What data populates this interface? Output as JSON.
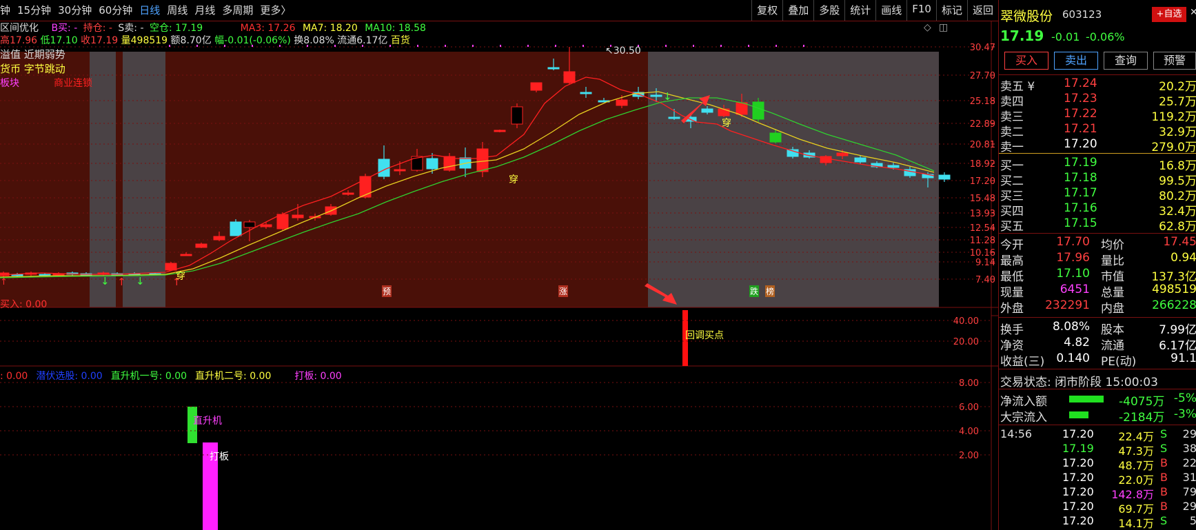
{
  "toolbar": {
    "periods": [
      {
        "label": "钟",
        "active": false
      },
      {
        "label": "15分钟",
        "active": false
      },
      {
        "label": "30分钟",
        "active": false
      },
      {
        "label": "60分钟",
        "active": false
      },
      {
        "label": "日线",
        "active": true
      },
      {
        "label": "周线",
        "active": false
      },
      {
        "label": "月线",
        "active": false
      },
      {
        "label": "多周期",
        "active": false
      },
      {
        "label": "更多",
        "active": false
      }
    ],
    "more_arrow": "〉",
    "right_items": [
      "复权",
      "叠加",
      "多股",
      "统计",
      "画线",
      "F10",
      "标记",
      "返回"
    ]
  },
  "info_line1": {
    "name": "区间优化",
    "b_buy": "B买: -",
    "hold": "持仓: -",
    "s_sell": "S卖: -",
    "empty": "空仓: 17.19",
    "ma3": "MA3: 17.26",
    "ma7": "MA7: 18.20",
    "ma10": "MA10: 18.58"
  },
  "info_line2": {
    "high": "高17.96",
    "low": "低17.10",
    "close": "收17.19",
    "vol": "量498519",
    "amount": "额8.70亿",
    "change": "幅-0.01(-0.06%)",
    "turnover": "换8.08%",
    "float": "流通6.17亿",
    "industry": "百货"
  },
  "overlay_tags": {
    "line1": "溢值 近期弱势",
    "line2": "货币 字节跳动",
    "line3a": "板块",
    "line3b": "商业连锁"
  },
  "price_axis": [
    "30.47",
    "27.70",
    "25.18",
    "22.89",
    "20.81",
    "18.92",
    "17.20",
    "15.48",
    "13.93",
    "12.54",
    "11.28",
    "10.16",
    "9.14",
    "7.40"
  ],
  "peak_label": "30.50",
  "chart_markers": {
    "chuan": "穿",
    "yu": "预",
    "zhang": "涨",
    "die": "跌",
    "bang": "榜"
  },
  "sub1": {
    "label": "买入: 0.00",
    "axis": [
      "40.00",
      "20.00"
    ],
    "signal_text": "回调买点"
  },
  "sub2": {
    "items": [
      {
        "text": ": 0.00",
        "color": "#ff3030"
      },
      {
        "text": "潜伏选股: 0.00",
        "color": "#2040ff"
      },
      {
        "text": "直升机一号: 0.00",
        "color": "#40ff40"
      },
      {
        "text": "直升机二号: 0.00",
        "color": "#ffff40"
      },
      {
        "text": "打板: 0.00",
        "color": "#ff40ff"
      }
    ],
    "axis": [
      "8.00",
      "6.00",
      "4.00",
      "2.00"
    ],
    "zhishengji": "直升机",
    "daban": "打板"
  },
  "stock": {
    "name": "翠微股份",
    "code": "603123",
    "add_btn": "+自选",
    "price": "17.19",
    "change": "-0.01",
    "pct": "-0.06%",
    "buttons": [
      "买入",
      "卖出",
      "查询",
      "预警"
    ]
  },
  "sells": [
    {
      "label": "卖五 ¥",
      "price": "17.24",
      "vol": "20.2万"
    },
    {
      "label": "卖四",
      "price": "17.23",
      "vol": "25.7万"
    },
    {
      "label": "卖三",
      "price": "17.22",
      "vol": "119.2万"
    },
    {
      "label": "卖二",
      "price": "17.21",
      "vol": "32.9万"
    },
    {
      "label": "卖一",
      "price": "17.20",
      "vol": "279.0万"
    }
  ],
  "buys": [
    {
      "label": "买一",
      "price": "17.19",
      "vol": "16.8万"
    },
    {
      "label": "买二",
      "price": "17.18",
      "vol": "99.5万"
    },
    {
      "label": "买三",
      "price": "17.17",
      "vol": "80.2万"
    },
    {
      "label": "买四",
      "price": "17.16",
      "vol": "32.4万"
    },
    {
      "label": "买五",
      "price": "17.15",
      "vol": "62.8万"
    }
  ],
  "stats": [
    {
      "l1": "今开",
      "v1": "17.70",
      "c1": "#ff4040",
      "l2": "均价",
      "v2": "17.45",
      "c2": "#ff4040"
    },
    {
      "l1": "最高",
      "v1": "17.96",
      "c1": "#ff4040",
      "l2": "量比",
      "v2": "0.94",
      "c2": "#ffff40"
    },
    {
      "l1": "最低",
      "v1": "17.10",
      "c1": "#40ff40",
      "l2": "市值",
      "v2": "137.3亿",
      "c2": "#ffff40"
    },
    {
      "l1": "现量",
      "v1": "6451",
      "c1": "#ff40ff",
      "l2": "总量",
      "v2": "498519",
      "c2": "#ffff40"
    },
    {
      "l1": "外盘",
      "v1": "232291",
      "c1": "#ff4040",
      "l2": "内盘",
      "v2": "266228",
      "c2": "#40ff40"
    }
  ],
  "stats2": [
    {
      "l1": "换手",
      "v1": "8.08%",
      "l2": "股本",
      "v2": "7.99亿"
    },
    {
      "l1": "净资",
      "v1": "4.82",
      "l2": "流通",
      "v2": "6.17亿"
    },
    {
      "l1": "收益(三)",
      "v1": "0.140",
      "l2": "PE(动)",
      "v2": "91.1"
    }
  ],
  "trade_state": "交易状态: 闭市阶段 15:00:03",
  "flows": [
    {
      "label": "净流入额",
      "val": "-4075万",
      "pct": "-5%",
      "bar": 0.8
    },
    {
      "label": "大宗流入",
      "val": "-2184万",
      "pct": "-3%",
      "bar": 0.45
    }
  ],
  "ticks_time": "14:56",
  "ticks": [
    {
      "price": "17.20",
      "vol": "22.4万",
      "side": "S",
      "num": "29",
      "pc": "#ffffff",
      "vc": "#ffff40",
      "sc": "#40ff40"
    },
    {
      "price": "17.19",
      "vol": "47.3万",
      "side": "S",
      "num": "38",
      "pc": "#40ff40",
      "vc": "#ffff40",
      "sc": "#40ff40"
    },
    {
      "price": "17.20",
      "vol": "48.7万",
      "side": "B",
      "num": "22",
      "pc": "#ffffff",
      "vc": "#ffff40",
      "sc": "#ff4040"
    },
    {
      "price": "17.20",
      "vol": "22.0万",
      "side": "B",
      "num": "31",
      "pc": "#ffffff",
      "vc": "#ffff40",
      "sc": "#ff4040"
    },
    {
      "price": "17.20",
      "vol": "142.8万",
      "side": "B",
      "num": "79",
      "pc": "#ffffff",
      "vc": "#ff40ff",
      "sc": "#ff4040"
    },
    {
      "price": "17.20",
      "vol": "69.7万",
      "side": "B",
      "num": "29",
      "pc": "#ffffff",
      "vc": "#ffff40",
      "sc": "#ff4040"
    },
    {
      "price": "17.20",
      "vol": "14.1万",
      "side": "S",
      "num": "5",
      "pc": "#ffffff",
      "vc": "#ffff40",
      "sc": "#40ff40"
    }
  ]
}
